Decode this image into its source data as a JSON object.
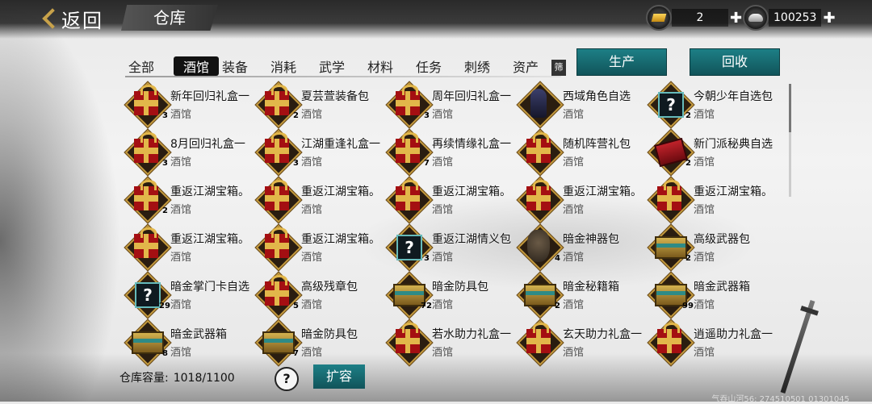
{
  "header": {
    "back_label": "返回",
    "title": "仓库"
  },
  "currency": {
    "gold": {
      "value": "2",
      "icon": "gold-ingot-icon"
    },
    "silver": {
      "value": "100253",
      "icon": "silver-ingot-icon"
    }
  },
  "tabs": [
    {
      "label": "全部",
      "active": false
    },
    {
      "label": "酒馆",
      "active": true
    },
    {
      "label": "装备",
      "active": false
    },
    {
      "label": "消耗",
      "active": false
    },
    {
      "label": "武学",
      "active": false
    },
    {
      "label": "材料",
      "active": false
    },
    {
      "label": "任务",
      "active": false
    },
    {
      "label": "刺绣",
      "active": false
    },
    {
      "label": "资产",
      "active": false
    }
  ],
  "filter_label": "筛",
  "actions": {
    "produce": "生产",
    "recycle": "回收"
  },
  "items": [
    {
      "name": "新年回归礼盒一",
      "category": "酒馆",
      "count": "3",
      "icon": "gift"
    },
    {
      "name": "夏芸萱装备包",
      "category": "酒馆",
      "count": "2",
      "icon": "gift"
    },
    {
      "name": "周年回归礼盒一",
      "category": "酒馆",
      "count": "3",
      "icon": "gift"
    },
    {
      "name": "西域角色自选",
      "category": "酒馆",
      "count": "",
      "icon": "figure"
    },
    {
      "name": "今朝少年自选包",
      "category": "酒馆",
      "count": "2",
      "icon": "mystery"
    },
    {
      "name": "8月回归礼盒一",
      "category": "酒馆",
      "count": "3",
      "icon": "gift"
    },
    {
      "name": "江湖重逢礼盒一",
      "category": "酒馆",
      "count": "3",
      "icon": "gift"
    },
    {
      "name": "再续情缘礼盒一",
      "category": "酒馆",
      "count": "7",
      "icon": "gift"
    },
    {
      "name": "随机阵营礼包",
      "category": "酒馆",
      "count": "",
      "icon": "gift"
    },
    {
      "name": "新门派秘典自选",
      "category": "酒馆",
      "count": "2",
      "icon": "book"
    },
    {
      "name": "重返江湖宝箱。",
      "category": "酒馆",
      "count": "2",
      "icon": "gift"
    },
    {
      "name": "重返江湖宝箱。",
      "category": "酒馆",
      "count": "",
      "icon": "gift"
    },
    {
      "name": "重返江湖宝箱。",
      "category": "酒馆",
      "count": "",
      "icon": "gift"
    },
    {
      "name": "重返江湖宝箱。",
      "category": "酒馆",
      "count": "",
      "icon": "gift"
    },
    {
      "name": "重返江湖宝箱。",
      "category": "酒馆",
      "count": "",
      "icon": "gift"
    },
    {
      "name": "重返江湖宝箱。",
      "category": "酒馆",
      "count": "",
      "icon": "gift"
    },
    {
      "name": "重返江湖宝箱。",
      "category": "酒馆",
      "count": "",
      "icon": "gift"
    },
    {
      "name": "重返江湖情义包",
      "category": "酒馆",
      "count": "3",
      "icon": "mystery"
    },
    {
      "name": "暗金神器包",
      "category": "酒馆",
      "count": "4",
      "icon": "mask"
    },
    {
      "name": "高级武器包",
      "category": "酒馆",
      "count": "2",
      "icon": "box"
    },
    {
      "name": "暗金掌门卡自选",
      "category": "酒馆",
      "count": "29",
      "icon": "mystery"
    },
    {
      "name": "高级残章包",
      "category": "酒馆",
      "count": "5",
      "icon": "gift"
    },
    {
      "name": "暗金防具包",
      "category": "酒馆",
      "count": "72",
      "icon": "box"
    },
    {
      "name": "暗金秘籍箱",
      "category": "酒馆",
      "count": "2",
      "icon": "box"
    },
    {
      "name": "暗金武器箱",
      "category": "酒馆",
      "count": "99",
      "icon": "box"
    },
    {
      "name": "暗金武器箱",
      "category": "酒馆",
      "count": "8",
      "icon": "box"
    },
    {
      "name": "暗金防具包",
      "category": "酒馆",
      "count": "7",
      "icon": "box"
    },
    {
      "name": "若水助力礼盒一",
      "category": "酒馆",
      "count": "",
      "icon": "gift"
    },
    {
      "name": "玄天助力礼盒一",
      "category": "酒馆",
      "count": "",
      "icon": "gift"
    },
    {
      "name": "逍遥助力礼盒一",
      "category": "酒馆",
      "count": "",
      "icon": "gift"
    }
  ],
  "footer": {
    "capacity_label": "仓库容量:",
    "capacity_value": "1018/1100",
    "help_label": "?",
    "expand_label": "扩容",
    "server_info": "气吞山河56: 274510501  01301045"
  },
  "colors": {
    "accent_teal": "#1d7f86",
    "gold_frame": "#c49a3e",
    "gift_red": "#a40f12"
  }
}
